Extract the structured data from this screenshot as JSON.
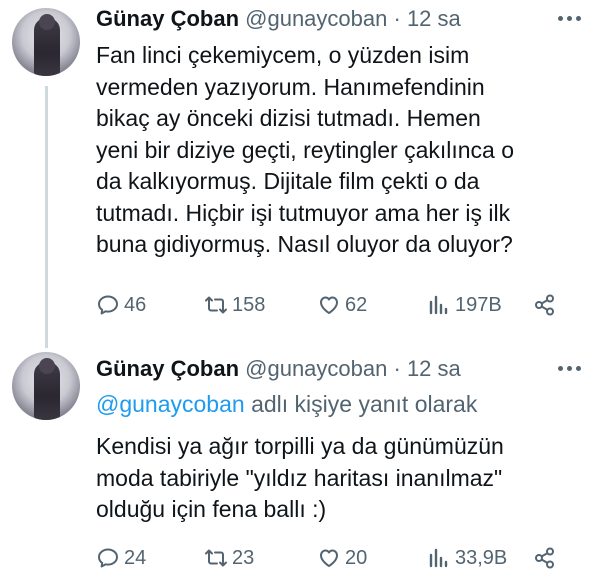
{
  "tweets": [
    {
      "author_name": "Günay Çoban",
      "handle": "@gunaycoban",
      "time": "12 sa",
      "text": "Fan linci çekemiycem, o yüzden isim\nvermeden yazıyorum. Hanımefendinin\nbikaç ay önceki dizisi tutmadı. Hemen\nyeni bir diziye geçti, reytingler çakılınca o\nda kalkıyormuş. Dijitale film çekti o da\ntutmadı. Hiçbir işi tutmuyor ama her iş ilk\nbuna gidiyormuş. Nasıl oluyor da oluyor?",
      "replies": "46",
      "retweets": "158",
      "likes": "62",
      "views": "197B"
    },
    {
      "author_name": "Günay Çoban",
      "handle": "@gunaycoban",
      "time": "12 sa",
      "reply_mention": "@gunaycoban",
      "reply_suffix": "adlı kişiye yanıt olarak",
      "text": "Kendisi ya ağır torpilli ya da günümüzün\nmoda tabiriyle \"yıldız haritası inanılmaz\"\nolduğu için fena ballı :)",
      "replies": "24",
      "retweets": "23",
      "likes": "20",
      "views": "33,9B"
    }
  ],
  "separator": "·",
  "colors": {
    "text": "#0f1419",
    "muted": "#536471",
    "link": "#1d9bf0",
    "thread_line": "#cfd9de"
  }
}
